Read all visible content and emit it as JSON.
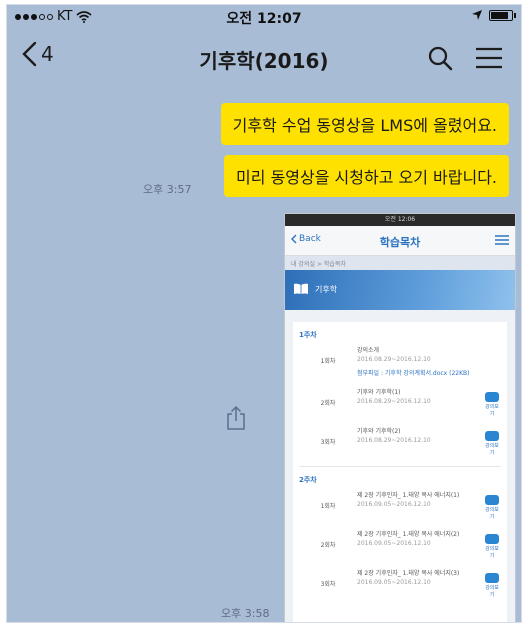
{
  "status_bar": {
    "carrier": "KT",
    "time": "오전 12:07",
    "battery_level": 0.9
  },
  "header": {
    "back_count": "4",
    "title": "기후학(2016)"
  },
  "messages": [
    {
      "text": "기후학 수업 동영상을 LMS에 올렸어요."
    },
    {
      "text": "미리 동영상을 시청하고 오기 바랍니다."
    }
  ],
  "timestamps": {
    "first": "오후 3:57",
    "second": "오후 3:58"
  },
  "attachment": {
    "status_time": "오전 12:06",
    "back_label": "Back",
    "title": "학습목차",
    "breadcrumb": "내 강의실 > 학습목차",
    "course_name": "기후학",
    "video_button_label": "강의보기",
    "weeks": [
      {
        "label": "1주차",
        "items": [
          {
            "no": "1회차",
            "title": "강의소개",
            "date": "2016.08.29~2016.12.10",
            "extra": "첨부파일 : 기후학 강의계획서.docx (22KB)"
          },
          {
            "no": "2회차",
            "title": "기후와 기후학(1)",
            "date": "2016.08.29~2016.12.10",
            "extra": ""
          },
          {
            "no": "3회차",
            "title": "기후와 기후학(2)",
            "date": "2016.08.29~2016.12.10",
            "extra": ""
          }
        ]
      },
      {
        "label": "2주차",
        "items": [
          {
            "no": "1회차",
            "title": "제 2장 기후인자_ 1.태양 복사 에너지(1)",
            "date": "2016.09.05~2016.12.10",
            "extra": ""
          },
          {
            "no": "2회차",
            "title": "제 2장 기후인자_ 1.태양 복사 에너지(2)",
            "date": "2016.09.05~2016.12.10",
            "extra": ""
          },
          {
            "no": "3회차",
            "title": "제 2장 기후인자_ 1.태양 복사 에너지(3)",
            "date": "2016.09.05~2016.12.10",
            "extra": ""
          }
        ]
      }
    ]
  }
}
